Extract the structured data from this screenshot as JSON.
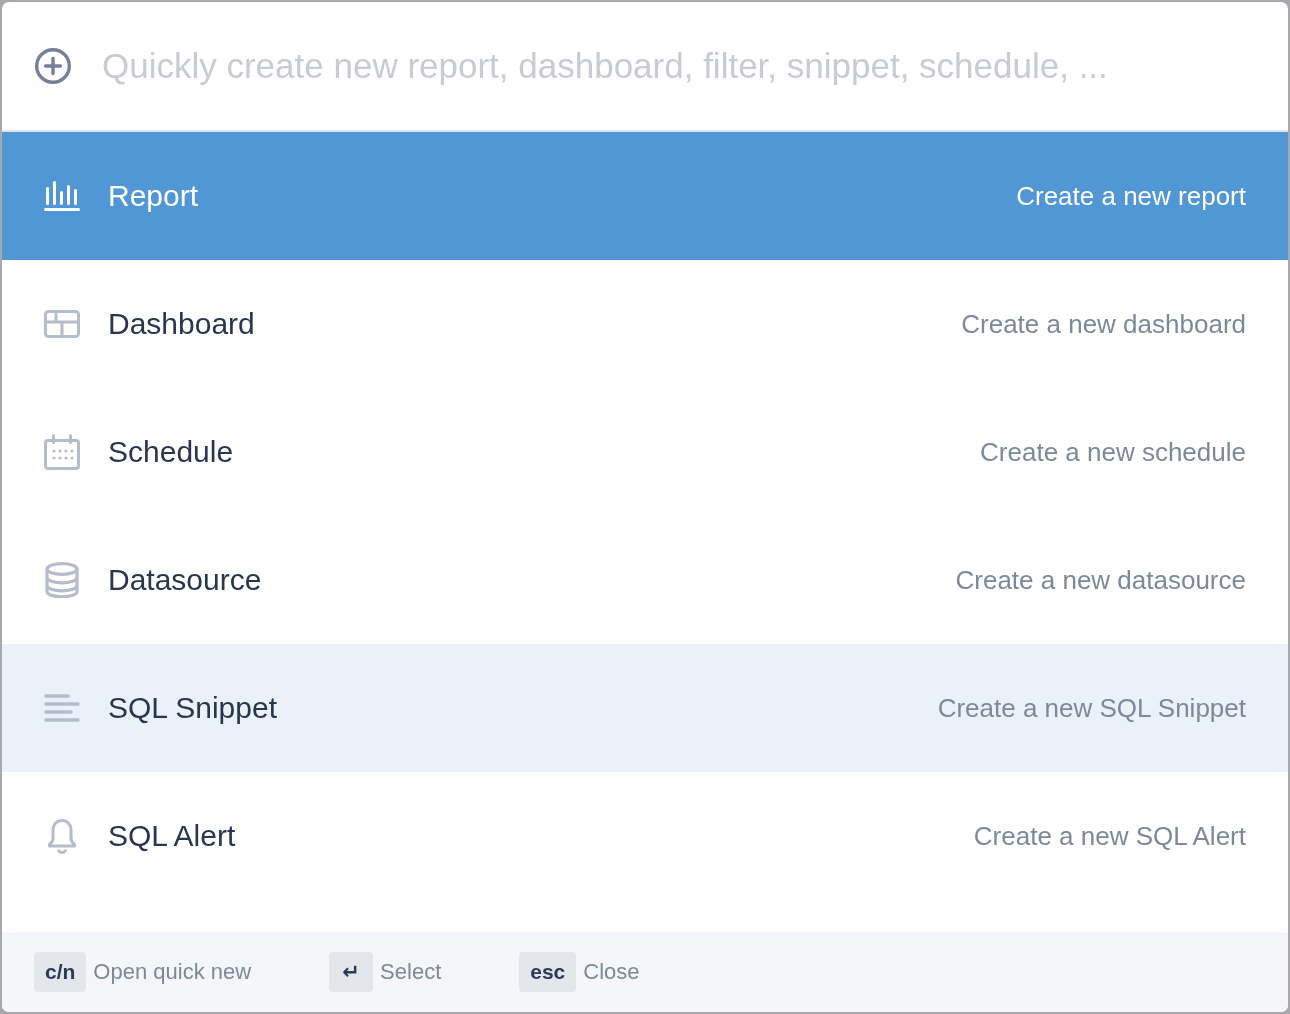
{
  "search": {
    "placeholder": "Quickly create new report, dashboard, filter, snippet, schedule, ..."
  },
  "items": [
    {
      "kind": "report",
      "label": "Report",
      "description": "Create a new report",
      "selected": true,
      "hovered": false
    },
    {
      "kind": "dashboard",
      "label": "Dashboard",
      "description": "Create a new dashboard",
      "selected": false,
      "hovered": false
    },
    {
      "kind": "schedule",
      "label": "Schedule",
      "description": "Create a new schedule",
      "selected": false,
      "hovered": false
    },
    {
      "kind": "datasource",
      "label": "Datasource",
      "description": "Create a new datasource",
      "selected": false,
      "hovered": false
    },
    {
      "kind": "snippet",
      "label": "SQL Snippet",
      "description": "Create a new SQL Snippet",
      "selected": false,
      "hovered": true
    },
    {
      "kind": "alert",
      "label": "SQL Alert",
      "description": "Create a new SQL Alert",
      "selected": false,
      "hovered": false
    }
  ],
  "footer": {
    "shortcuts": [
      {
        "key": "c/n",
        "label": "Open quick new"
      },
      {
        "key": "↵",
        "label": "Select"
      },
      {
        "key": "esc",
        "label": "Close"
      }
    ]
  }
}
